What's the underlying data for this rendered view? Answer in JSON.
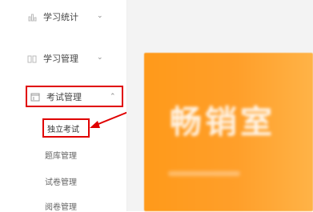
{
  "sidebar": {
    "items": [
      {
        "label": "学习统计",
        "icon": "chart-icon",
        "expanded": false
      },
      {
        "label": "学习管理",
        "icon": "book-icon",
        "expanded": false
      },
      {
        "label": "考试管理",
        "icon": "exam-icon",
        "expanded": true
      }
    ],
    "submenu": [
      {
        "label": "独立考试",
        "active": true
      },
      {
        "label": "题库管理"
      },
      {
        "label": "试卷管理"
      },
      {
        "label": "阅卷管理"
      }
    ]
  },
  "banner": {
    "text": "畅销室"
  },
  "annotation": {
    "highlight_color": "#e00000"
  }
}
